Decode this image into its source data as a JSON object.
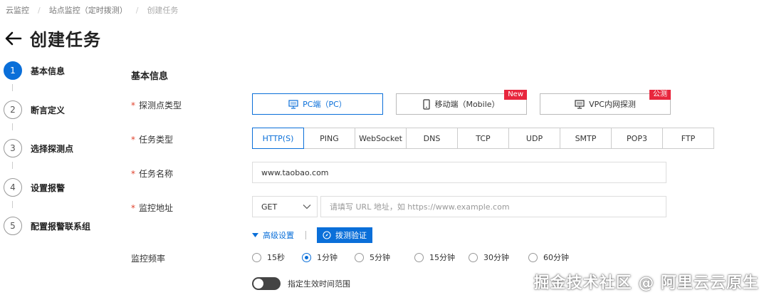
{
  "breadcrumb": [
    "云监控",
    "站点监控（定时拨测）",
    "创建任务"
  ],
  "page": {
    "title": "创建任务"
  },
  "steps": [
    {
      "num": "1",
      "label": "基本信息",
      "active": true
    },
    {
      "num": "2",
      "label": "断言定义",
      "active": false
    },
    {
      "num": "3",
      "label": "选择探测点",
      "active": false
    },
    {
      "num": "4",
      "label": "设置报警",
      "active": false
    },
    {
      "num": "5",
      "label": "配置报警联系组",
      "active": false
    }
  ],
  "form": {
    "section_title": "基本信息",
    "required_mark": "*",
    "probe_type": {
      "label": "探测点类型",
      "options": [
        {
          "label": "PC端（PC）",
          "icon": "monitor-icon",
          "selected": true,
          "tag": ""
        },
        {
          "label": "移动端（Mobile）",
          "icon": "mobile-icon",
          "selected": false,
          "tag": "New"
        },
        {
          "label": "VPC内网探测",
          "icon": "monitor-icon",
          "selected": false,
          "tag": "公测"
        }
      ]
    },
    "task_type": {
      "label": "任务类型",
      "options": [
        "HTTP(S)",
        "PING",
        "WebSocket",
        "DNS",
        "TCP",
        "UDP",
        "SMTP",
        "POP3",
        "FTP"
      ],
      "selected": "HTTP(S)"
    },
    "task_name": {
      "label": "任务名称",
      "value": "www.taobao.com"
    },
    "monitor_address": {
      "label": "监控地址",
      "method": "GET",
      "placeholder": "请填写 URL 地址，如 https://www.example.com"
    },
    "advanced": {
      "label": "高级设置"
    },
    "verify_button": {
      "label": "拨测验证"
    },
    "frequency": {
      "label": "监控频率",
      "options": [
        "15秒",
        "1分钟",
        "5分钟",
        "15分钟",
        "30分钟",
        "60分钟"
      ],
      "selected": "1分钟"
    },
    "time_range_switch": {
      "label": "指定生效时间范围",
      "on": false
    }
  },
  "watermark": "掘金技术社区 @ 阿里云云原生",
  "colors": {
    "primary": "#0a6fd9",
    "tag": "#e8263d",
    "required": "#e0442e"
  }
}
